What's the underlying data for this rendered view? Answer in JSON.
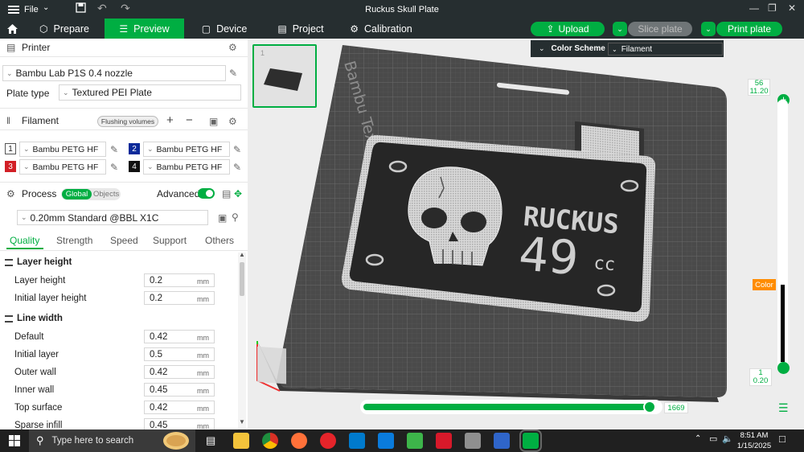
{
  "titlebar": {
    "file_label": "File",
    "title": "Ruckus Skull Plate"
  },
  "tabs": [
    {
      "label": "Prepare",
      "icon": "cube-icon"
    },
    {
      "label": "Preview",
      "icon": "layers-icon"
    },
    {
      "label": "Device",
      "icon": "monitor-icon"
    },
    {
      "label": "Project",
      "icon": "project-icon"
    },
    {
      "label": "Calibration",
      "icon": "calibration-icon"
    }
  ],
  "actions": {
    "upload": "Upload",
    "slice": "Slice plate",
    "print": "Print plate"
  },
  "printer": {
    "heading": "Printer",
    "model": "Bambu Lab P1S 0.4 nozzle",
    "plate_type_label": "Plate type",
    "plate_type": "Textured PEI Plate"
  },
  "filament": {
    "heading": "Filament",
    "flushing_label": "Flushing volumes",
    "slots": [
      {
        "num": "1",
        "name": "Bambu PETG HF",
        "color": "#ffffff"
      },
      {
        "num": "2",
        "name": "Bambu PETG HF",
        "color": "#0b2a9a"
      },
      {
        "num": "3",
        "name": "Bambu PETG HF",
        "color": "#d21f26"
      },
      {
        "num": "4",
        "name": "Bambu PETG HF",
        "color": "#111111"
      }
    ]
  },
  "process": {
    "heading": "Process",
    "global_label": "Global",
    "objects_label": "Objects",
    "advanced_label": "Advanced",
    "preset": "0.20mm Standard @BBL X1C",
    "tabs": [
      "Quality",
      "Strength",
      "Speed",
      "Support",
      "Others"
    ],
    "groups": [
      {
        "title": "Layer height",
        "rows": [
          {
            "label": "Layer height",
            "value": "0.2",
            "unit": "mm"
          },
          {
            "label": "Initial layer height",
            "value": "0.2",
            "unit": "mm"
          }
        ]
      },
      {
        "title": "Line width",
        "rows": [
          {
            "label": "Default",
            "value": "0.42",
            "unit": "mm"
          },
          {
            "label": "Initial layer",
            "value": "0.5",
            "unit": "mm"
          },
          {
            "label": "Outer wall",
            "value": "0.42",
            "unit": "mm"
          },
          {
            "label": "Inner wall",
            "value": "0.45",
            "unit": "mm"
          },
          {
            "label": "Top surface",
            "value": "0.42",
            "unit": "mm"
          },
          {
            "label": "Sparse infill",
            "value": "0.45",
            "unit": "mm"
          }
        ]
      }
    ]
  },
  "viewport": {
    "color_scheme_label": "Color Scheme",
    "color_scheme_value": "Filament",
    "plate_text": "Bambu Textured PEI Plate",
    "model_text_1": "RUCKUS",
    "model_text_2": "49",
    "model_text_3": "cc",
    "thumb_number": "1",
    "layer_top": "56",
    "layer_top_height": "11.20",
    "layer_bottom": "1",
    "layer_bottom_height": "0.20",
    "color_tag": "Color",
    "moves_value": "1669",
    "moves_fraction": 0.99
  },
  "taskbar": {
    "search_placeholder": "Type here to search",
    "time": "8:51 AM",
    "date": "1/15/2025"
  },
  "colors": {
    "accent": "#00ae42",
    "color_tag": "#ff8c00"
  }
}
